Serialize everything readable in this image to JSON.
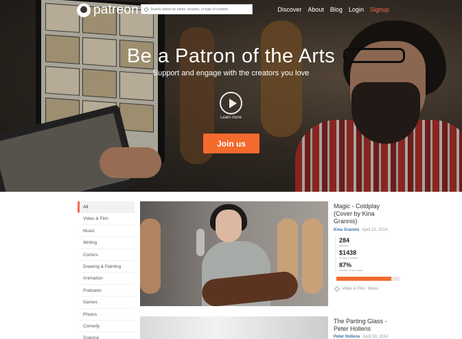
{
  "nav": {
    "logo_text": "patreon",
    "search_placeholder": "Search artists by name, location, or type of content",
    "links": [
      "Discover",
      "About",
      "Blog",
      "Login",
      "Signup"
    ]
  },
  "hero": {
    "title": "Be a Patron of the Arts",
    "subtitle": "Support and engage with the creators you love",
    "learn_more": "Learn more",
    "join_label": "Join us"
  },
  "sidebar": {
    "items": [
      "All",
      "Video & Film",
      "Music",
      "Writing",
      "Comics",
      "Drawing & Painting",
      "Animation",
      "Podcasts",
      "Games",
      "Photos",
      "Comedy",
      "Science"
    ],
    "active": "All"
  },
  "cards": [
    {
      "title": "Magic - Coldplay (Cover by Kina Grannis)",
      "creator": "Kina Grannis",
      "date": "April 22, 2014",
      "patrons_value": "284",
      "patrons_label": "patrons",
      "amount_value": "$1438",
      "amount_label": "for this creation",
      "percent_value": "87%",
      "percent_label": "funded of next goal",
      "progress": 0.87,
      "tags": [
        "Video & Film",
        "Music"
      ]
    },
    {
      "title": "The Parting Glass - Peter Hollens",
      "creator": "Peter Hollens",
      "date": "April 30, 2014"
    }
  ],
  "colors": {
    "accent": "#f46a2d",
    "signup": "#f96854",
    "link": "#3a6ea5"
  }
}
